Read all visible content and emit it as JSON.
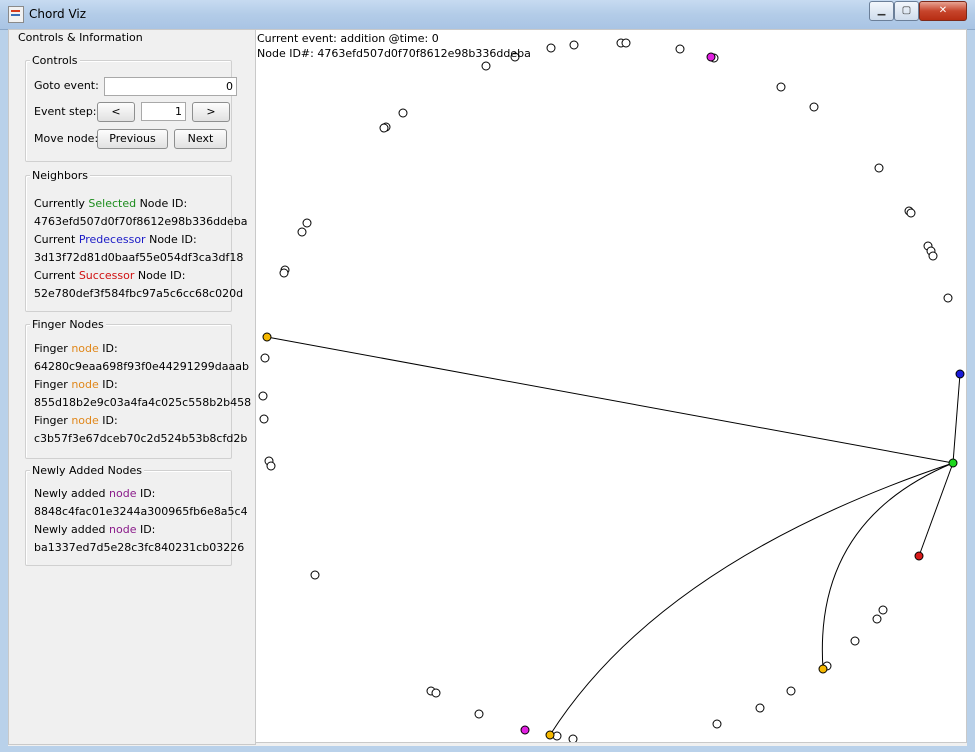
{
  "window": {
    "title": "Chord Viz",
    "min_glyph": "▁",
    "max_glyph": "▢",
    "close_glyph": "✕"
  },
  "left_panel": {
    "title": "Controls & Information",
    "controls": {
      "title": "Controls",
      "goto_label": "Goto event:",
      "goto_value": "0",
      "step_label": "Event step:",
      "step_prev": "<",
      "step_value": "1",
      "step_next": ">",
      "move_label": "Move node:",
      "previous": "Previous",
      "next": "Next"
    },
    "neighbors": {
      "title": "Neighbors",
      "selected_pre": "Currently ",
      "selected_word": "Selected",
      "selected_post": " Node ID:",
      "selected_id": "4763efd507d0f70f8612e98b336ddeba",
      "pred_pre": "Current ",
      "pred_word": "Predecessor",
      "pred_post": " Node ID:",
      "pred_id": "3d13f72d81d0baaf55e054df3ca3df18",
      "succ_pre": "Current ",
      "succ_word": "Successor",
      "succ_post": " Node ID:",
      "succ_id": "52e780def3f584fbc97a5c6cc68c020d"
    },
    "fingers": {
      "title": "Finger Nodes",
      "label_pre": "Finger ",
      "label_word": "node",
      "label_post": " ID:",
      "ids": [
        "64280c9eaa698f93f0e44291299daaab",
        "855d18b2e9c03a4fa4c025c558b2b458",
        "c3b57f3e67dceb70c2d524b53b8cfd2b"
      ]
    },
    "new_nodes": {
      "title": "Newly Added Nodes",
      "label_pre": "Newly added ",
      "label_word": "node",
      "label_post": " ID:",
      "ids": [
        "8848c4fac01e3244a300965fb6e8a5c4",
        "ba1337ed7d5e28c3fc840231cb03226"
      ]
    }
  },
  "canvas": {
    "event_text": "Current event: addition @time: 0",
    "node_text": "Node ID#: 4763efd507d0f70f8612e98b336ddeba",
    "colors": {
      "selected": "#1ed81e",
      "predecessor": "#1a1ad8",
      "successor": "#d81a1a",
      "finger": "#f5b800",
      "new": "#e020e0",
      "plain": "#ffffff"
    }
  }
}
